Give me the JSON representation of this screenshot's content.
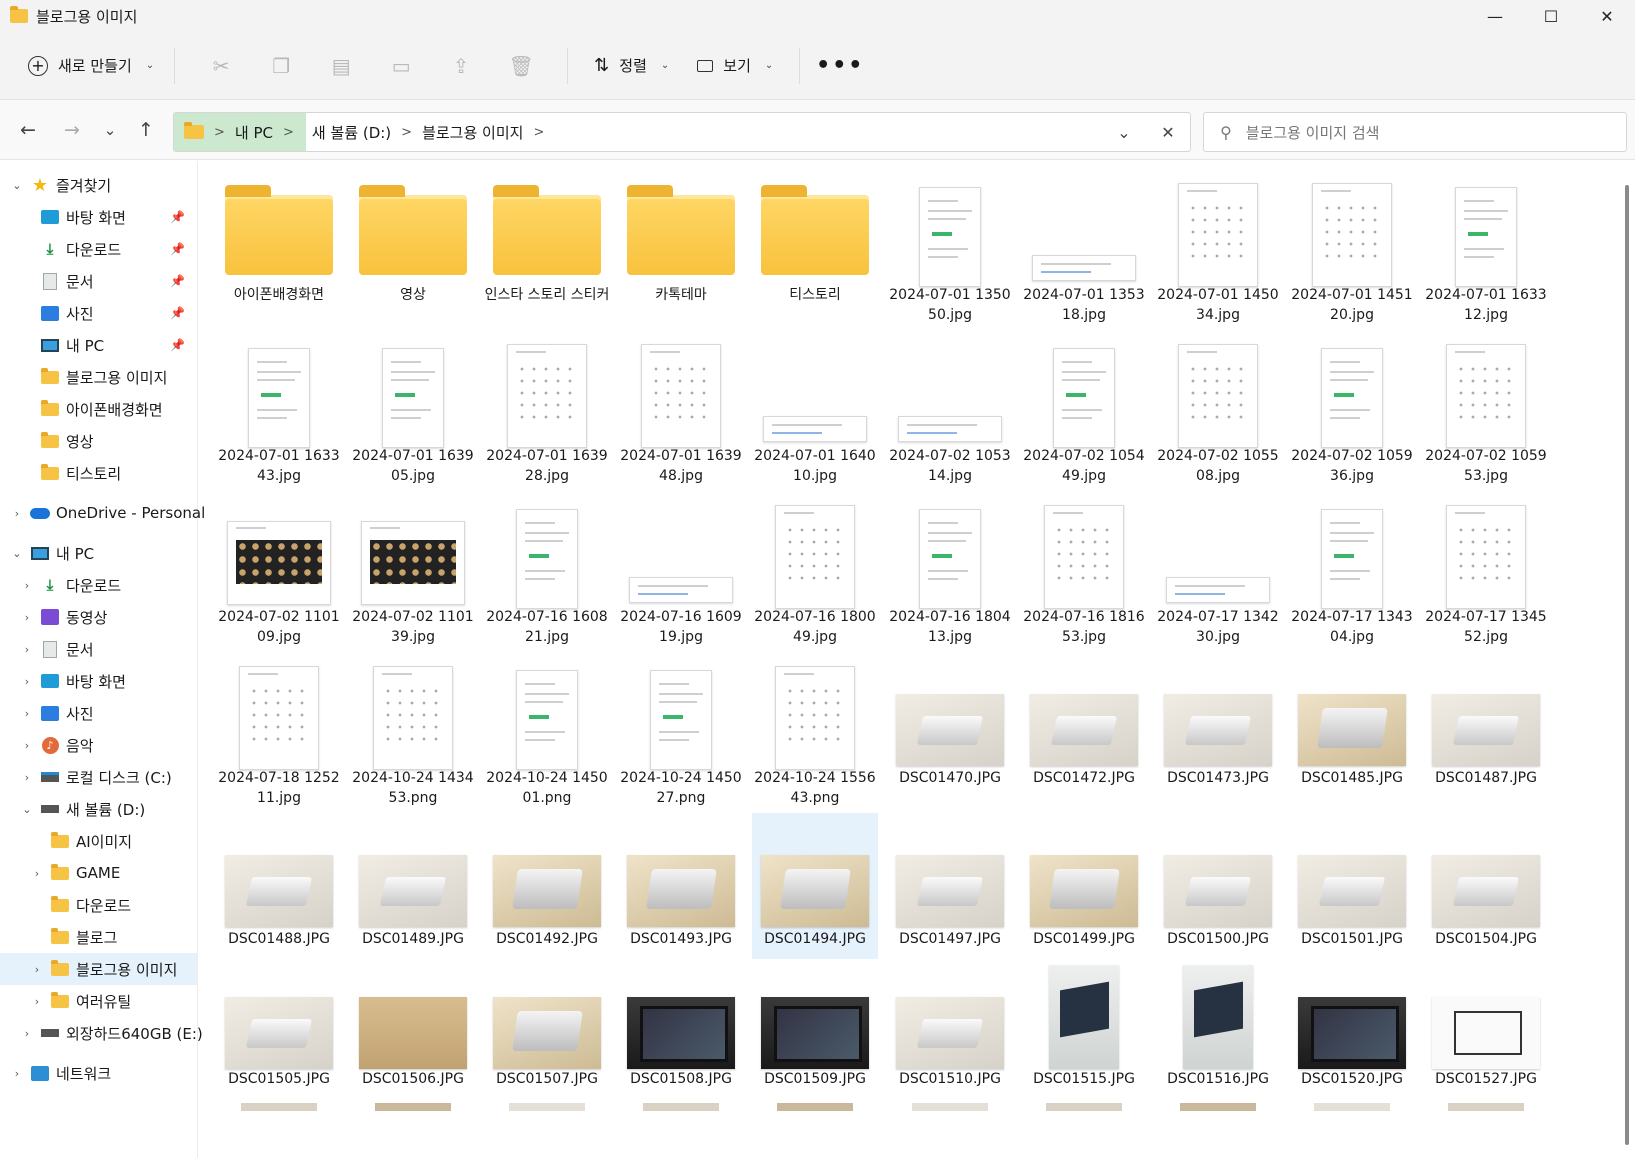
{
  "window": {
    "title": "블로그용 이미지",
    "minimize": "—",
    "maximize": "☐",
    "close": "✕"
  },
  "toolbar": {
    "new_label": "새로 만들기",
    "sort_label": "정렬",
    "view_label": "보기",
    "more": "•••"
  },
  "nav": {
    "back": "←",
    "forward": "→",
    "recent": "⌄",
    "up": "↑"
  },
  "address": {
    "crumbs": [
      "내 PC",
      "새 볼륨 (D:)",
      "블로그용 이미지"
    ],
    "sep": ">",
    "dropdown": "⌄",
    "clear": "✕"
  },
  "search": {
    "placeholder": "블로그용 이미지 검색",
    "icon": "search-icon"
  },
  "sidebar": {
    "quick_access": "즐겨찾기",
    "quick_items": [
      "바탕 화면",
      "다운로드",
      "문서",
      "사진",
      "내 PC",
      "블로그용 이미지",
      "아이폰배경화면",
      "영상",
      "티스토리"
    ],
    "onedrive": "OneDrive - Personal",
    "this_pc": "내 PC",
    "pc_items": [
      "다운로드",
      "동영상",
      "문서",
      "바탕 화면",
      "사진",
      "음악",
      "로컬 디스크 (C:)",
      "새 볼륨 (D:)"
    ],
    "d_items": [
      "AI이미지",
      "GAME",
      "다운로드",
      "블로그",
      "블로그용 이미지",
      "여러유틸"
    ],
    "external": "외장하드640GB (E:)",
    "network": "네트워크"
  },
  "files": [
    {
      "name": "아이폰배경화면",
      "kind": "folder"
    },
    {
      "name": "영상",
      "kind": "folder"
    },
    {
      "name": "인스타 스토리 스티커",
      "kind": "folder"
    },
    {
      "name": "카톡테마",
      "kind": "folder"
    },
    {
      "name": "티스토리",
      "kind": "folder"
    },
    {
      "name": "2024-07-01 1350 50.jpg",
      "kind": "doc"
    },
    {
      "name": "2024-07-01 1353 18.jpg",
      "kind": "banner"
    },
    {
      "name": "2024-07-01 1450 34.jpg",
      "kind": "grid"
    },
    {
      "name": "2024-07-01 1451 20.jpg",
      "kind": "grid"
    },
    {
      "name": "2024-07-01 1633 12.jpg",
      "kind": "doc"
    },
    {
      "name": "2024-07-01 1633 43.jpg",
      "kind": "doc"
    },
    {
      "name": "2024-07-01 1639 05.jpg",
      "kind": "doc"
    },
    {
      "name": "2024-07-01 1639 28.jpg",
      "kind": "grid"
    },
    {
      "name": "2024-07-01 1639 48.jpg",
      "kind": "grid"
    },
    {
      "name": "2024-07-01 1640 10.jpg",
      "kind": "banner"
    },
    {
      "name": "2024-07-02 1053 14.jpg",
      "kind": "banner"
    },
    {
      "name": "2024-07-02 1054 49.jpg",
      "kind": "doc"
    },
    {
      "name": "2024-07-02 1055 08.jpg",
      "kind": "grid"
    },
    {
      "name": "2024-07-02 1059 36.jpg",
      "kind": "doc"
    },
    {
      "name": "2024-07-02 1059 53.jpg",
      "kind": "grid"
    },
    {
      "name": "2024-07-02 1101 09.jpg",
      "kind": "dark"
    },
    {
      "name": "2024-07-02 1101 39.jpg",
      "kind": "dark"
    },
    {
      "name": "2024-07-16 1608 21.jpg",
      "kind": "doc"
    },
    {
      "name": "2024-07-16 1609 19.jpg",
      "kind": "banner"
    },
    {
      "name": "2024-07-16 1800 49.jpg",
      "kind": "grid"
    },
    {
      "name": "2024-07-16 1804 13.jpg",
      "kind": "doc"
    },
    {
      "name": "2024-07-16 1816 53.jpg",
      "kind": "grid"
    },
    {
      "name": "2024-07-17 1342 30.jpg",
      "kind": "banner"
    },
    {
      "name": "2024-07-17 1343 04.jpg",
      "kind": "doc"
    },
    {
      "name": "2024-07-17 1345 52.jpg",
      "kind": "grid"
    },
    {
      "name": "2024-07-18 1252 11.jpg",
      "kind": "grid"
    },
    {
      "name": "2024-10-24 1434 53.png",
      "kind": "grid"
    },
    {
      "name": "2024-10-24 1450 01.png",
      "kind": "doc"
    },
    {
      "name": "2024-10-24 1450 27.png",
      "kind": "doc"
    },
    {
      "name": "2024-10-24 1556 43.png",
      "kind": "grid"
    },
    {
      "name": "DSC01470.JPG",
      "kind": "p-light"
    },
    {
      "name": "DSC01472.JPG",
      "kind": "p-light"
    },
    {
      "name": "DSC01473.JPG",
      "kind": "p-light"
    },
    {
      "name": "DSC01485.JPG",
      "kind": "p-warm"
    },
    {
      "name": "DSC01487.JPG",
      "kind": "p-light"
    },
    {
      "name": "DSC01488.JPG",
      "kind": "p-light"
    },
    {
      "name": "DSC01489.JPG",
      "kind": "p-light"
    },
    {
      "name": "DSC01492.JPG",
      "kind": "p-warm"
    },
    {
      "name": "DSC01493.JPG",
      "kind": "p-warm"
    },
    {
      "name": "DSC01494.JPG",
      "kind": "p-warm",
      "selected": true
    },
    {
      "name": "DSC01497.JPG",
      "kind": "p-light"
    },
    {
      "name": "DSC01499.JPG",
      "kind": "p-warm"
    },
    {
      "name": "DSC01500.JPG",
      "kind": "p-light"
    },
    {
      "name": "DSC01501.JPG",
      "kind": "p-light"
    },
    {
      "name": "DSC01504.JPG",
      "kind": "p-light"
    },
    {
      "name": "DSC01505.JPG",
      "kind": "p-light"
    },
    {
      "name": "DSC01506.JPG",
      "kind": "p-box"
    },
    {
      "name": "DSC01507.JPG",
      "kind": "p-warm"
    },
    {
      "name": "DSC01508.JPG",
      "kind": "p-dark"
    },
    {
      "name": "DSC01509.JPG",
      "kind": "p-dark"
    },
    {
      "name": "DSC01510.JPG",
      "kind": "p-light"
    },
    {
      "name": "DSC01515.JPG",
      "kind": "p-laptop"
    },
    {
      "name": "DSC01516.JPG",
      "kind": "p-laptop"
    },
    {
      "name": "DSC01520.JPG",
      "kind": "p-dark"
    },
    {
      "name": "DSC01527.JPG",
      "kind": "p-pattern"
    }
  ]
}
